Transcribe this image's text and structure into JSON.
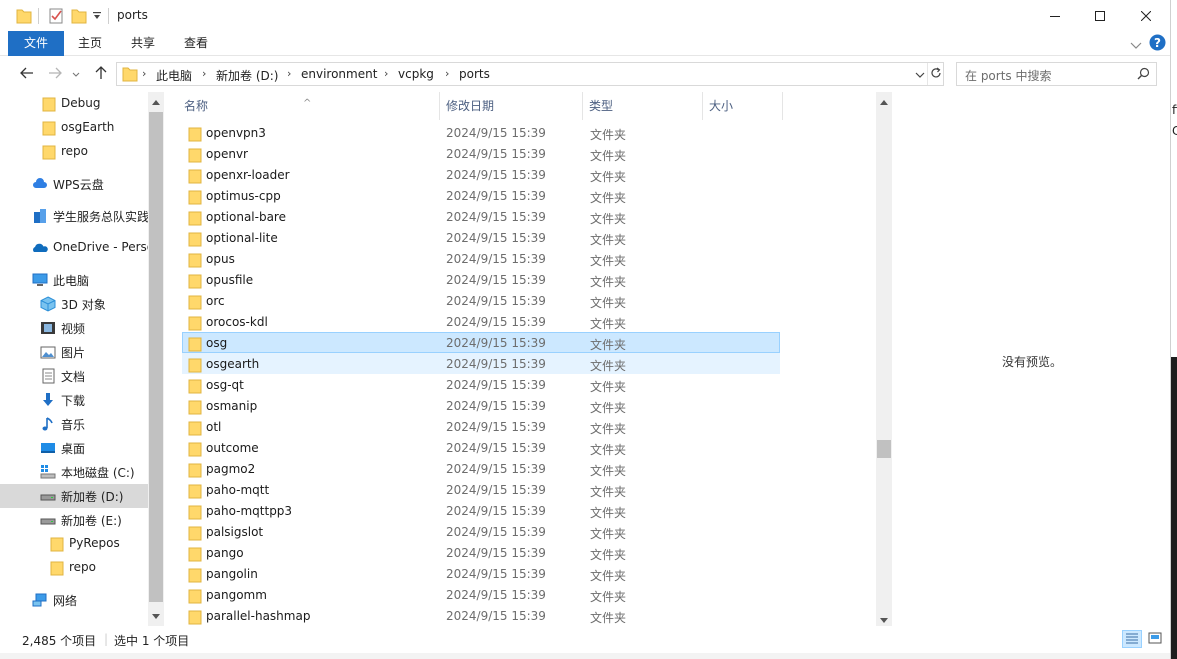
{
  "window": {
    "title": "ports",
    "minimize_icon": "minimize-icon",
    "maximize_icon": "maximize-icon",
    "close_icon": "close-icon"
  },
  "ribbon": {
    "tabs": [
      "文件",
      "主页",
      "共享",
      "查看"
    ],
    "active_tab": "文件",
    "accent": "#1f6fc5"
  },
  "address": {
    "crumbs": [
      "此电脑",
      "新加卷 (D:)",
      "environment",
      "vcpkg",
      "ports"
    ]
  },
  "search": {
    "placeholder": "在 ports 中搜索"
  },
  "nav_pane": {
    "items": [
      {
        "label": "Debug",
        "icon": "folder-icon"
      },
      {
        "label": "osgEarth",
        "icon": "folder-icon"
      },
      {
        "label": "repo",
        "icon": "folder-icon"
      },
      {
        "label": "WPS云盘",
        "icon": "cloud-icon"
      },
      {
        "label": "学生服务总队实践",
        "icon": "building-icon"
      },
      {
        "label": "OneDrive - Perso",
        "icon": "onedrive-icon"
      },
      {
        "label": "此电脑",
        "icon": "computer-icon"
      },
      {
        "label": "3D 对象",
        "icon": "3d-objects-icon"
      },
      {
        "label": "视频",
        "icon": "video-icon"
      },
      {
        "label": "图片",
        "icon": "pictures-icon"
      },
      {
        "label": "文档",
        "icon": "documents-icon"
      },
      {
        "label": "下载",
        "icon": "download-icon"
      },
      {
        "label": "音乐",
        "icon": "music-icon"
      },
      {
        "label": "桌面",
        "icon": "desktop-icon"
      },
      {
        "label": "本地磁盘 (C:)",
        "icon": "windows-drive-icon"
      },
      {
        "label": "新加卷 (D:)",
        "icon": "drive-icon"
      },
      {
        "label": "新加卷 (E:)",
        "icon": "drive-icon"
      },
      {
        "label": "PyRepos",
        "icon": "folder-icon"
      },
      {
        "label": "repo",
        "icon": "folder-icon"
      },
      {
        "label": "网络",
        "icon": "network-icon"
      }
    ],
    "selected": "新加卷 (D:)"
  },
  "file_list": {
    "columns": [
      "名称",
      "修改日期",
      "类型",
      "大小"
    ],
    "rows": [
      {
        "name": "openvpn3",
        "date": "2024/9/15 15:39",
        "type": "文件夹"
      },
      {
        "name": "openvr",
        "date": "2024/9/15 15:39",
        "type": "文件夹"
      },
      {
        "name": "openxr-loader",
        "date": "2024/9/15 15:39",
        "type": "文件夹"
      },
      {
        "name": "optimus-cpp",
        "date": "2024/9/15 15:39",
        "type": "文件夹"
      },
      {
        "name": "optional-bare",
        "date": "2024/9/15 15:39",
        "type": "文件夹"
      },
      {
        "name": "optional-lite",
        "date": "2024/9/15 15:39",
        "type": "文件夹"
      },
      {
        "name": "opus",
        "date": "2024/9/15 15:39",
        "type": "文件夹"
      },
      {
        "name": "opusfile",
        "date": "2024/9/15 15:39",
        "type": "文件夹"
      },
      {
        "name": "orc",
        "date": "2024/9/15 15:39",
        "type": "文件夹"
      },
      {
        "name": "orocos-kdl",
        "date": "2024/9/15 15:39",
        "type": "文件夹"
      },
      {
        "name": "osg",
        "date": "2024/9/15 15:39",
        "type": "文件夹",
        "state": "selected"
      },
      {
        "name": "osgearth",
        "date": "2024/9/15 15:39",
        "type": "文件夹",
        "state": "hover"
      },
      {
        "name": "osg-qt",
        "date": "2024/9/15 15:39",
        "type": "文件夹"
      },
      {
        "name": "osmanip",
        "date": "2024/9/15 15:39",
        "type": "文件夹"
      },
      {
        "name": "otl",
        "date": "2024/9/15 15:39",
        "type": "文件夹"
      },
      {
        "name": "outcome",
        "date": "2024/9/15 15:39",
        "type": "文件夹"
      },
      {
        "name": "pagmo2",
        "date": "2024/9/15 15:39",
        "type": "文件夹"
      },
      {
        "name": "paho-mqtt",
        "date": "2024/9/15 15:39",
        "type": "文件夹"
      },
      {
        "name": "paho-mqttpp3",
        "date": "2024/9/15 15:39",
        "type": "文件夹"
      },
      {
        "name": "palsigslot",
        "date": "2024/9/15 15:39",
        "type": "文件夹"
      },
      {
        "name": "pango",
        "date": "2024/9/15 15:39",
        "type": "文件夹"
      },
      {
        "name": "pangolin",
        "date": "2024/9/15 15:39",
        "type": "文件夹"
      },
      {
        "name": "pangomm",
        "date": "2024/9/15 15:39",
        "type": "文件夹"
      },
      {
        "name": "parallel-hashmap",
        "date": "2024/9/15 15:39",
        "type": "文件夹"
      }
    ]
  },
  "preview": {
    "message": "没有预览。"
  },
  "status": {
    "item_count": "2,485 个项目",
    "selection": "选中 1 个项目"
  },
  "background_window": {
    "chars": [
      "fi",
      "C"
    ]
  }
}
